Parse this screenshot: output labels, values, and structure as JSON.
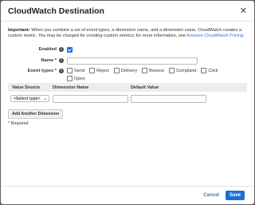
{
  "dialog": {
    "title": "CloudWatch Destination",
    "close_glyph": "✕"
  },
  "notice": {
    "lead": "Important:",
    "text": " When you combine a set of event types, a dimension name, and a dimension value, CloudWatch creates a custom metric. You may be charged for creating custom metrics; for more information, see ",
    "link": "Amazon CloudWatch Pricing",
    "end": "."
  },
  "form": {
    "enabled_label": "Enabled",
    "enabled_checked": true,
    "name_label": "Name *",
    "name_value": "",
    "event_types_label": "Event types *",
    "event_types": [
      {
        "label": "Send",
        "checked": false
      },
      {
        "label": "Reject",
        "checked": false
      },
      {
        "label": "Delivery",
        "checked": false
      },
      {
        "label": "Bounce",
        "checked": false
      },
      {
        "label": "Complaint",
        "checked": false
      },
      {
        "label": "Click",
        "checked": false
      },
      {
        "label": "Open",
        "checked": false
      }
    ],
    "info_glyph": "i"
  },
  "table": {
    "headers": [
      "Value Source",
      "Dimension Name",
      "Default Value"
    ],
    "row": {
      "select_value": "<Select type>",
      "dimension_name": "",
      "default_value": ""
    }
  },
  "add_button": "Add Another Dimension",
  "required_note": "* Required",
  "footer": {
    "cancel": "Cancel",
    "save": "Save"
  },
  "colors": {
    "accent": "#1f6fd0",
    "link": "#2a7bd6"
  }
}
